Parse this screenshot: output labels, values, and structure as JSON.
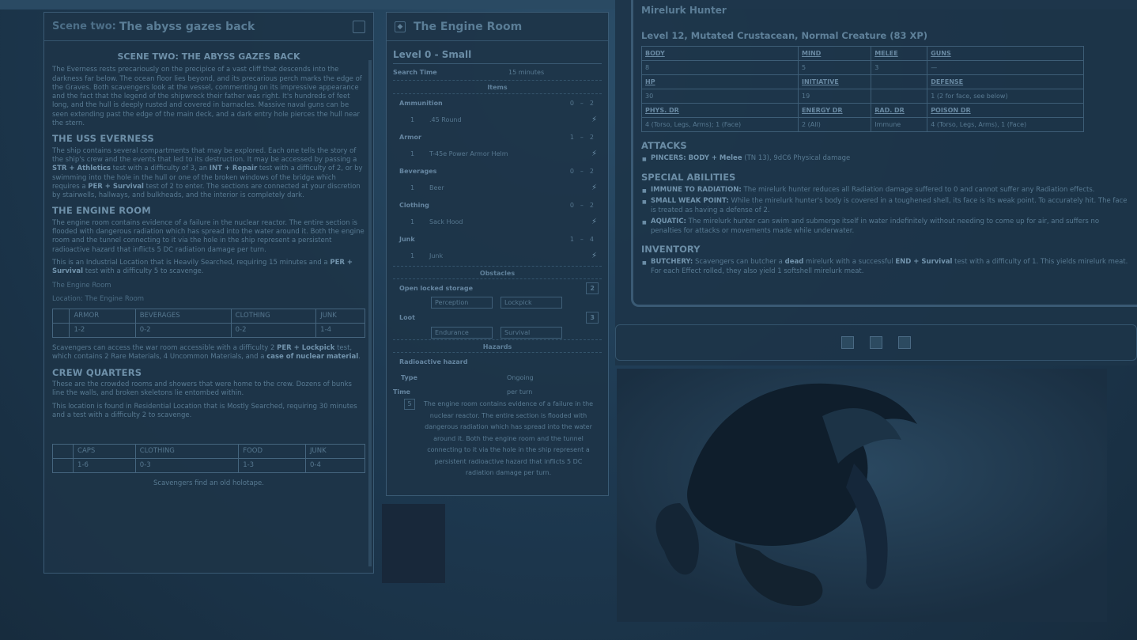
{
  "journal": {
    "title_prefix": "Scene two:",
    "title": "The abyss gazes back",
    "scene_title": "SCENE TWO: THE ABYSS GAZES BACK",
    "intro": "The Everness rests precariously on the precipice of a vast cliff that descends into the darkness far below. The ocean floor lies beyond, and its precarious perch marks the edge of the Graves. Both scavengers look at the vessel, commenting on its impressive appearance and the fact that the legend of the shipwreck their father was right. It's hundreds of feet long, and the hull is deeply rusted and covered in barnacles. Massive naval guns can be seen extending past the edge of the main deck, and a dark entry hole pierces the hull near the stern.",
    "h_uss": "THE USS EVERNESS",
    "uss_text_1": "The ship contains several compartments that may be explored. Each one tells the story of the ship's crew and the events that led to its destruction. It may be accessed by passing a",
    "uss_b1": "STR + Athletics",
    "uss_text_2": "test with a difficulty of 3, an",
    "uss_b2": "INT + Repair",
    "uss_text_3": "test with a difficulty of 2, or by swimming into the hole in the hull or one of the broken windows of the bridge which requires a",
    "uss_b3": "PER + Survival",
    "uss_text_4": "test of 2 to enter. The sections are connected at your discretion by stairwells, hallways, and bulkheads, and the interior is completely dark.",
    "h_engine": "THE ENGINE ROOM",
    "engine_text": "The engine room contains evidence of a failure in the nuclear reactor. The entire section is flooded with dangerous radiation which has spread into the water around it. Both the engine room and the tunnel connecting to it via the hole in the ship represent a persistent radioactive hazard that inflicts 5 DC radiation damage per turn.",
    "engine_loc_1": "This is an Industrial Location that is Heavily Searched, requiring 15 minutes and a",
    "engine_loc_b": "PER + Survival",
    "engine_loc_2": "test with a difficulty 5 to scavenge.",
    "engine_line1": "The Engine Room",
    "engine_line2": "Location: The Engine Room",
    "engine_table": [
      [
        "",
        "ARMOR",
        "BEVERAGES",
        "CLOTHING",
        "JUNK"
      ],
      [
        "",
        "1-2",
        "0-2",
        "0-2",
        "1-4"
      ]
    ],
    "engine_after_1": "Scavengers can access the war room accessible with a difficulty 2",
    "engine_after_b1": "PER + Lockpick",
    "engine_after_2": "test, which contains 2 Rare Materials, 4 Uncommon Materials, and a",
    "engine_after_b2": "case of nuclear material",
    "h_crew": "CREW QUARTERS",
    "crew_text": "These are the crowded rooms and showers that were home to the crew. Dozens of bunks line the walls, and broken skeletons lie entombed within.",
    "crew_loc": "This location is found in Residential Location that is Mostly Searched, requiring 30 minutes and a test with a difficulty 2 to scavenge.",
    "crew_table": [
      [
        "",
        "CAPS",
        "CLOTHING",
        "FOOD",
        "JUNK"
      ],
      [
        "",
        "1-6",
        "0-3",
        "1-3",
        "0-4"
      ]
    ],
    "crew_after": "Scavengers find an old holotape."
  },
  "engine": {
    "title": "The Engine Room",
    "level": "Level 0 - Small",
    "search_time_label": "Search Time",
    "search_time_value": "15 minutes",
    "items_label": "Items",
    "categories": [
      {
        "name": "Ammunition",
        "min": "0",
        "max": "2",
        "item_qty": "1",
        "item_name": ".45 Round"
      },
      {
        "name": "Armor",
        "min": "1",
        "max": "2",
        "item_qty": "1",
        "item_name": "T-45e Power Armor Helm"
      },
      {
        "name": "Beverages",
        "min": "0",
        "max": "2",
        "item_qty": "1",
        "item_name": "Beer"
      },
      {
        "name": "Clothing",
        "min": "0",
        "max": "2",
        "item_qty": "1",
        "item_name": "Sack Hood"
      },
      {
        "name": "Junk",
        "min": "1",
        "max": "4",
        "item_qty": "1",
        "item_name": "Junk"
      }
    ],
    "dash": "–",
    "bolt": "⚡",
    "obstacles_label": "Obstacles",
    "open_locked_label": "Open locked storage",
    "open_locked_value": "2",
    "perception": "Perception",
    "lockpick": "Lockpick",
    "loot_label": "Loot",
    "loot_value": "3",
    "endurance": "Endurance",
    "survival": "Survival",
    "hazards_label": "Hazards",
    "hazard_name": "Radioactive hazard",
    "type_label": "Type",
    "type_value": "Ongoing",
    "time_label": "Time",
    "time_value": "per turn",
    "hazard_num": "5",
    "hazard_text": "The engine room contains evidence of a failure in the nuclear reactor. The entire section is flooded with dangerous radiation which has spread into the water around it. Both the engine room and the tunnel connecting to it via the hole in the ship represent a persistent radioactive hazard that inflicts 5 DC radiation damage per turn."
  },
  "creature": {
    "name": "Mirelurk Hunter",
    "level": "Level 12, Mutated Crustacean, Normal Creature (83 XP)",
    "stats": [
      [
        "BODY",
        "MIND",
        "MELEE",
        "GUNS"
      ],
      [
        "8",
        "5",
        "3",
        "—"
      ],
      [
        "HP",
        "INITIATIVE",
        "",
        "DEFENSE"
      ],
      [
        "30",
        "19",
        "",
        "1 (2 for face, see below)"
      ],
      [
        "PHYS. DR",
        "ENERGY DR",
        "RAD. DR",
        "POISON DR"
      ],
      [
        "4 (Torso, Legs, Arms); 1 (Face)",
        "2 (All)",
        "Immune",
        "4 (Torso, Legs, Arms), 1 (Face)"
      ]
    ],
    "h_attacks": "ATTACKS",
    "attack_b": "PINCERS: BODY + Melee",
    "attack_text": "(TN 13), 9dC6 Physical damage",
    "h_special": "SPECIAL ABILITIES",
    "abilities": [
      {
        "b": "IMMUNE TO RADIATION:",
        "t": "The mirelurk hunter reduces all Radiation damage suffered to 0 and cannot suffer any Radiation effects."
      },
      {
        "b": "SMALL WEAK POINT:",
        "t": "While the mirelurk hunter's body is covered in a toughened shell, its face is its weak point. To accurately hit. The face is treated as having a defense of 2."
      },
      {
        "b": "AQUATIC:",
        "t": "The mirelurk hunter can swim and submerge itself in water indefinitely without needing to come up for air, and suffers no penalties for attacks or movements made while underwater."
      }
    ],
    "h_inventory": "INVENTORY",
    "inv_b": "BUTCHERY:",
    "inv_text_1": "Scavengers can butcher a",
    "inv_b2": "dead",
    "inv_text_2": "mirelurk with a successful",
    "inv_b3": "END + Survival",
    "inv_text_3": "test with a difficulty of 1. This yields mirelurk meat. For each Effect rolled, they also yield 1 softshell mirelurk meat."
  },
  "colors": {
    "background": "#1a3247",
    "panel": "#1d3448",
    "text": "#6f8fa6"
  }
}
